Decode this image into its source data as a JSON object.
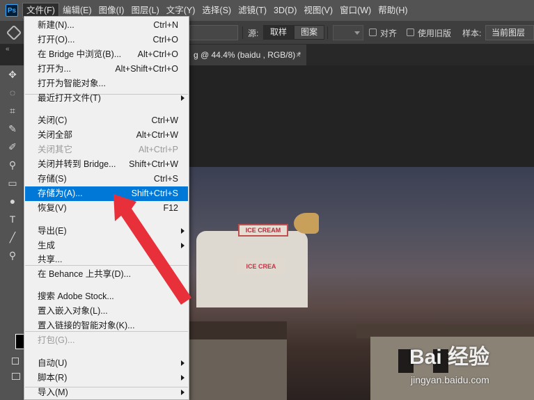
{
  "menubar": {
    "logo": "Ps",
    "items": [
      "文件(F)",
      "编辑(E)",
      "图像(I)",
      "图层(L)",
      "文字(Y)",
      "选择(S)",
      "滤镜(T)",
      "3D(D)",
      "视图(V)",
      "窗口(W)",
      "帮助(H)"
    ]
  },
  "options": {
    "source_label": "源:",
    "sampled": "取样",
    "pattern": "图案",
    "aligned": "对齐",
    "legacy": "使用旧版",
    "sample_label": "样本:",
    "sample_value": "当前图层"
  },
  "tab": {
    "title": "g @ 44.4% (baidu , RGB/8) *",
    "close": "×",
    "collapse": "«"
  },
  "file_menu": [
    {
      "label": "新建(N)...",
      "shortcut": "Ctrl+N"
    },
    {
      "label": "打开(O)...",
      "shortcut": "Ctrl+O"
    },
    {
      "label": "在 Bridge 中浏览(B)...",
      "shortcut": "Alt+Ctrl+O"
    },
    {
      "label": "打开为...",
      "shortcut": "Alt+Shift+Ctrl+O"
    },
    {
      "label": "打开为智能对象...",
      "shortcut": ""
    },
    {
      "label": "最近打开文件(T)",
      "shortcut": "",
      "submenu": true
    },
    {
      "label": "关闭(C)",
      "shortcut": "Ctrl+W"
    },
    {
      "label": "关闭全部",
      "shortcut": "Alt+Ctrl+W"
    },
    {
      "label": "关闭其它",
      "shortcut": "Alt+Ctrl+P",
      "disabled": true
    },
    {
      "label": "关闭并转到 Bridge...",
      "shortcut": "Shift+Ctrl+W"
    },
    {
      "label": "存储(S)",
      "shortcut": "Ctrl+S"
    },
    {
      "label": "存储为(A)...",
      "shortcut": "Shift+Ctrl+S",
      "highlight": true
    },
    {
      "label": "恢复(V)",
      "shortcut": "F12"
    },
    {
      "label": "导出(E)",
      "shortcut": "",
      "submenu": true
    },
    {
      "label": "生成",
      "shortcut": "",
      "submenu": true
    },
    {
      "label": "共享...",
      "shortcut": ""
    },
    {
      "label": "在 Behance 上共享(D)...",
      "shortcut": ""
    },
    {
      "label": "搜索 Adobe Stock...",
      "shortcut": ""
    },
    {
      "label": "置入嵌入对象(L)...",
      "shortcut": ""
    },
    {
      "label": "置入链接的智能对象(K)...",
      "shortcut": ""
    },
    {
      "label": "打包(G)...",
      "shortcut": "",
      "disabled": true
    },
    {
      "label": "自动(U)",
      "shortcut": "",
      "submenu": true
    },
    {
      "label": "脚本(R)",
      "shortcut": "",
      "submenu": true
    },
    {
      "label": "导入(M)",
      "shortcut": "",
      "submenu": true
    }
  ],
  "photo": {
    "van_sign": "ICE CREAM",
    "van_label": "ICE CREA"
  },
  "watermark": {
    "brand": "Bai 经验",
    "url": "jingyan.baidu.com"
  },
  "colors": {
    "menubar": "#535353",
    "highlight": "#0078d7",
    "arrow": "#e8303a"
  }
}
